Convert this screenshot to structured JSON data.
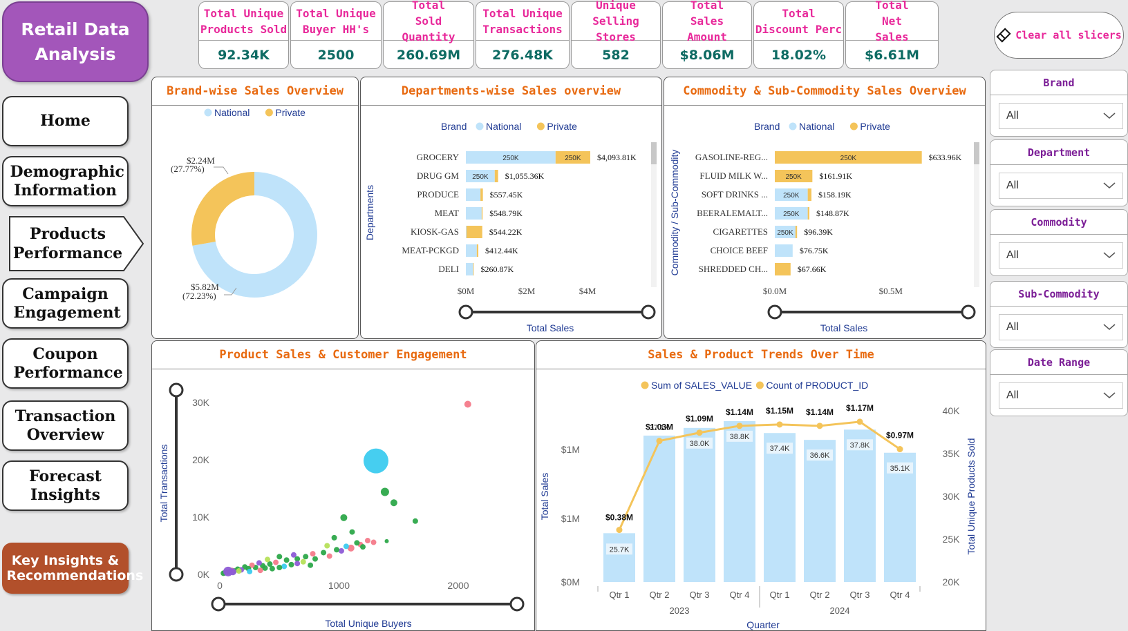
{
  "app": {
    "title": "Retail Data Analysis"
  },
  "nav": {
    "items": [
      {
        "label": "Home"
      },
      {
        "label": "Demographic Information"
      },
      {
        "label": "Products Performance"
      },
      {
        "label": "Campaign Engagement"
      },
      {
        "label": "Coupon Performance"
      },
      {
        "label": "Transaction Overview"
      },
      {
        "label": "Forecast Insights"
      }
    ],
    "insights_label": "Key Insights & Recommendations"
  },
  "kpis": [
    {
      "label": "Total Unique Products Sold",
      "value": "92.34K"
    },
    {
      "label": "Total Unique Buyer HH's",
      "value": "2500"
    },
    {
      "label": "Total Sold Quantity",
      "value": "260.69M"
    },
    {
      "label": "Total Unique Transactions",
      "value": "276.48K"
    },
    {
      "label": "Unique Selling Stores",
      "value": "582"
    },
    {
      "label": "Total Sales Amount",
      "value": "$8.06M"
    },
    {
      "label": "Total Discount Perc",
      "value": "18.02%"
    },
    {
      "label": "Total Net Sales",
      "value": "$6.61M"
    }
  ],
  "clear_slicers": {
    "label": "Clear all slicers",
    "icon": "eraser-icon"
  },
  "slicers": [
    {
      "title": "Brand",
      "value": "All"
    },
    {
      "title": "Department",
      "value": "All"
    },
    {
      "title": "Commodity",
      "value": "All"
    },
    {
      "title": "Sub-Commodity",
      "value": "All"
    },
    {
      "title": "Date Range",
      "value": "All"
    }
  ],
  "colors": {
    "national": "#bfe3fa",
    "private": "#f4c45a",
    "accent_title": "#e86a10",
    "kpi_label": "#e8289a",
    "kpi_value": "#0e6b63",
    "axis_title": "#1f3a93"
  },
  "chart_data": [
    {
      "id": "brand_donut",
      "type": "pie",
      "title": "Brand-wise Sales Overview",
      "legend": [
        "National",
        "Private"
      ],
      "slices": [
        {
          "name": "National",
          "value": 5.82,
          "label": "$5.82M",
          "pct_label": "(72.23%)"
        },
        {
          "name": "Private",
          "value": 2.24,
          "label": "$2.24M",
          "pct_label": "(27.77%)"
        }
      ]
    },
    {
      "id": "dept_bars",
      "type": "bar",
      "title": "Departments-wise Sales overview",
      "legend_title": "Brand",
      "legend": [
        "National",
        "Private"
      ],
      "ylabel": "Departments",
      "xlabel": "Total Sales",
      "xticks": [
        "$0M",
        "$2M",
        "$4M"
      ],
      "xlim": [
        0,
        5
      ],
      "categories": [
        "GROCERY",
        "DRUG GM",
        "PRODUCE",
        "MEAT",
        "KIOSK-GAS",
        "MEAT-PCKGD",
        "DELI"
      ],
      "series": [
        {
          "name": "National",
          "values": [
            2.95,
            0.95,
            0.48,
            0.52,
            0.02,
            0.36,
            0.24
          ]
        },
        {
          "name": "Private",
          "values": [
            1.14,
            0.11,
            0.08,
            0.03,
            0.52,
            0.05,
            0.02
          ]
        }
      ],
      "segment_labels": [
        [
          "250K",
          "250K"
        ],
        [
          "250K",
          ""
        ],
        [
          "",
          ""
        ],
        [
          "",
          ""
        ],
        [
          "",
          ""
        ],
        [
          "",
          ""
        ],
        [
          "",
          ""
        ]
      ],
      "total_labels": [
        "$4,093.81K",
        "$1,055.36K",
        "$557.45K",
        "$548.79K",
        "$544.22K",
        "$412.44K",
        "$260.87K"
      ]
    },
    {
      "id": "commodity_bars",
      "type": "bar",
      "title": "Commodity & Sub-Commodity Sales Overview",
      "legend_title": "Brand",
      "legend": [
        "National",
        "Private"
      ],
      "ylabel": "Commodity / Sub-Commodity",
      "xlabel": "Total Sales",
      "xticks": [
        "$0.0M",
        "$0.5M"
      ],
      "xlim": [
        0,
        0.79
      ],
      "categories": [
        "GASOLINE-REG...",
        "FLUID MILK W...",
        "SOFT DRINKS ...",
        "BEERALEMALT...",
        "CIGARETTES",
        "CHOICE BEEF",
        "SHREDDED CH..."
      ],
      "series": [
        {
          "name": "National",
          "values": [
            0.0,
            0.0,
            0.142,
            0.142,
            0.089,
            0.077,
            0.0
          ]
        },
        {
          "name": "Private",
          "values": [
            0.634,
            0.162,
            0.016,
            0.007,
            0.007,
            0.0,
            0.068
          ]
        }
      ],
      "segment_labels": [
        [
          "",
          "250K"
        ],
        [
          "",
          "250K"
        ],
        [
          "250K",
          ""
        ],
        [
          "250K",
          ""
        ],
        [
          "250K",
          ""
        ],
        [
          "",
          ""
        ],
        [
          "",
          ""
        ]
      ],
      "total_labels": [
        "$633.96K",
        "$161.91K",
        "$158.19K",
        "$148.87K",
        "$96.39K",
        "$76.75K",
        "$67.66K"
      ]
    },
    {
      "id": "engagement_scatter",
      "type": "scatter",
      "title": "Product Sales & Customer Engagement",
      "xlabel": "Total Unique Buyers",
      "ylabel": "Total Transactions",
      "xticks": [
        "0",
        "1000",
        "2000"
      ],
      "yticks": [
        "0K",
        "10K",
        "20K",
        "30K"
      ],
      "xlim": [
        0,
        2100
      ],
      "ylim": [
        0,
        30000
      ],
      "points": [
        {
          "x": 2080,
          "y": 29700,
          "size": 5,
          "color": "#f47a8a"
        },
        {
          "x": 1310,
          "y": 19800,
          "size": 18,
          "color": "#3ccbef"
        },
        {
          "x": 1385,
          "y": 14400,
          "size": 6,
          "color": "#2da84a"
        },
        {
          "x": 1460,
          "y": 12500,
          "size": 5,
          "color": "#2da84a"
        },
        {
          "x": 1640,
          "y": 9300,
          "size": 4,
          "color": "#2da84a"
        },
        {
          "x": 1040,
          "y": 9900,
          "size": 5,
          "color": "#2da84a"
        },
        {
          "x": 1110,
          "y": 7400,
          "size": 4,
          "color": "#2da84a"
        },
        {
          "x": 960,
          "y": 6400,
          "size": 4,
          "color": "#2da84a"
        },
        {
          "x": 1180,
          "y": 5200,
          "size": 4,
          "color": "#f47a8a"
        },
        {
          "x": 1290,
          "y": 5600,
          "size": 4,
          "color": "#f47a8a"
        },
        {
          "x": 1100,
          "y": 4600,
          "size": 5,
          "color": "#f47a8a"
        },
        {
          "x": 1020,
          "y": 4100,
          "size": 4,
          "color": "#8e5bd6"
        },
        {
          "x": 1400,
          "y": 5800,
          "size": 3,
          "color": "#2da84a"
        },
        {
          "x": 1200,
          "y": 4800,
          "size": 4,
          "color": "#2da84a"
        },
        {
          "x": 900,
          "y": 5000,
          "size": 4,
          "color": "#b6e05a"
        },
        {
          "x": 870,
          "y": 3800,
          "size": 4,
          "color": "#2da84a"
        },
        {
          "x": 780,
          "y": 3600,
          "size": 4,
          "color": "#f47a8a"
        },
        {
          "x": 720,
          "y": 3100,
          "size": 4,
          "color": "#2da84a"
        },
        {
          "x": 650,
          "y": 2700,
          "size": 4,
          "color": "#2da84a"
        },
        {
          "x": 620,
          "y": 3400,
          "size": 4,
          "color": "#8e5bd6"
        },
        {
          "x": 560,
          "y": 2500,
          "size": 4,
          "color": "#2da84a"
        },
        {
          "x": 500,
          "y": 3100,
          "size": 4,
          "color": "#2da84a"
        },
        {
          "x": 470,
          "y": 2100,
          "size": 4,
          "color": "#f47a8a"
        },
        {
          "x": 420,
          "y": 1800,
          "size": 4,
          "color": "#2da84a"
        },
        {
          "x": 400,
          "y": 2600,
          "size": 4,
          "color": "#b6e05a"
        },
        {
          "x": 360,
          "y": 1500,
          "size": 4,
          "color": "#2da84a"
        },
        {
          "x": 330,
          "y": 2000,
          "size": 4,
          "color": "#8e5bd6"
        },
        {
          "x": 300,
          "y": 1200,
          "size": 4,
          "color": "#2da84a"
        },
        {
          "x": 270,
          "y": 1600,
          "size": 4,
          "color": "#f47a8a"
        },
        {
          "x": 240,
          "y": 1000,
          "size": 4,
          "color": "#2da84a"
        },
        {
          "x": 210,
          "y": 1300,
          "size": 4,
          "color": "#2da84a"
        },
        {
          "x": 180,
          "y": 800,
          "size": 4,
          "color": "#8e5bd6"
        },
        {
          "x": 150,
          "y": 900,
          "size": 4,
          "color": "#2da84a"
        },
        {
          "x": 120,
          "y": 600,
          "size": 4,
          "color": "#2da84a"
        },
        {
          "x": 100,
          "y": 700,
          "size": 4,
          "color": "#f47a8a"
        },
        {
          "x": 80,
          "y": 400,
          "size": 4,
          "color": "#2da84a"
        },
        {
          "x": 60,
          "y": 350,
          "size": 4,
          "color": "#2da84a"
        },
        {
          "x": 40,
          "y": 250,
          "size": 4,
          "color": "#8e5bd6"
        },
        {
          "x": 30,
          "y": 200,
          "size": 4,
          "color": "#2da84a"
        },
        {
          "x": 600,
          "y": 1700,
          "size": 4,
          "color": "#2da84a"
        },
        {
          "x": 700,
          "y": 2200,
          "size": 4,
          "color": "#b6e05a"
        },
        {
          "x": 800,
          "y": 2700,
          "size": 4,
          "color": "#2da84a"
        },
        {
          "x": 540,
          "y": 1400,
          "size": 4,
          "color": "#3ccbef"
        },
        {
          "x": 250,
          "y": 500,
          "size": 4,
          "color": "#3ccbef"
        },
        {
          "x": 440,
          "y": 1000,
          "size": 4,
          "color": "#2da84a"
        },
        {
          "x": 340,
          "y": 700,
          "size": 4,
          "color": "#f47a8a"
        },
        {
          "x": 650,
          "y": 1900,
          "size": 4,
          "color": "#8e5bd6"
        },
        {
          "x": 920,
          "y": 3200,
          "size": 4,
          "color": "#f47a8a"
        },
        {
          "x": 980,
          "y": 4300,
          "size": 4,
          "color": "#2da84a"
        },
        {
          "x": 1150,
          "y": 5500,
          "size": 4,
          "color": "#2da84a"
        },
        {
          "x": 1240,
          "y": 5900,
          "size": 4,
          "color": "#f47a8a"
        },
        {
          "x": 1060,
          "y": 4900,
          "size": 4,
          "color": "#3ccbef"
        },
        {
          "x": 70,
          "y": 500,
          "size": 7,
          "color": "#8e5bd6"
        },
        {
          "x": 110,
          "y": 450,
          "size": 5,
          "color": "#8e5bd6"
        },
        {
          "x": 500,
          "y": 1200,
          "size": 4,
          "color": "#2da84a"
        },
        {
          "x": 760,
          "y": 1600,
          "size": 4,
          "color": "#2da84a"
        },
        {
          "x": 380,
          "y": 1100,
          "size": 4,
          "color": "#2da84a"
        },
        {
          "x": 160,
          "y": 600,
          "size": 4,
          "color": "#b6e05a"
        }
      ]
    },
    {
      "id": "trend_combo",
      "type": "bar",
      "title": "Sales & Product Trends Over Time",
      "legend": [
        "Sum of SALES_VALUE",
        "Count of PRODUCT_ID"
      ],
      "xlabel": "Quarter",
      "ylabel": "Total Sales",
      "y2label": "Total Unique Products Sold",
      "categories": [
        "Qtr 1",
        "Qtr 2",
        "Qtr 3",
        "Qtr 4",
        "Qtr 1",
        "Qtr 2",
        "Qtr 3",
        "Qtr 4"
      ],
      "years": [
        "2023",
        "2024"
      ],
      "bar_series": {
        "name": "Count of PRODUCT_ID",
        "values": [
          25.7,
          37.1,
          38.0,
          38.8,
          37.4,
          36.6,
          37.8,
          35.1
        ],
        "labels": [
          "25.7K",
          "37.1K",
          "38.0K",
          "38.8K",
          "37.4K",
          "36.6K",
          "37.8K",
          "35.1K"
        ]
      },
      "line_series": {
        "name": "Sum of SALES_VALUE",
        "values": [
          0.38,
          1.03,
          1.09,
          1.14,
          1.15,
          1.14,
          1.17,
          0.97
        ],
        "labels": [
          "$0.38M",
          "$1.03M",
          "$1.09M",
          "$1.14M",
          "$1.15M",
          "$1.14M",
          "$1.17M",
          "$0.97M"
        ]
      },
      "yticks": [
        "$0M",
        "$1M",
        "$1M"
      ],
      "y2ticks": [
        "20K",
        "25K",
        "30K",
        "35K",
        "40K"
      ],
      "y2lim": [
        20,
        40
      ],
      "ylim": [
        0,
        1.25
      ]
    }
  ]
}
